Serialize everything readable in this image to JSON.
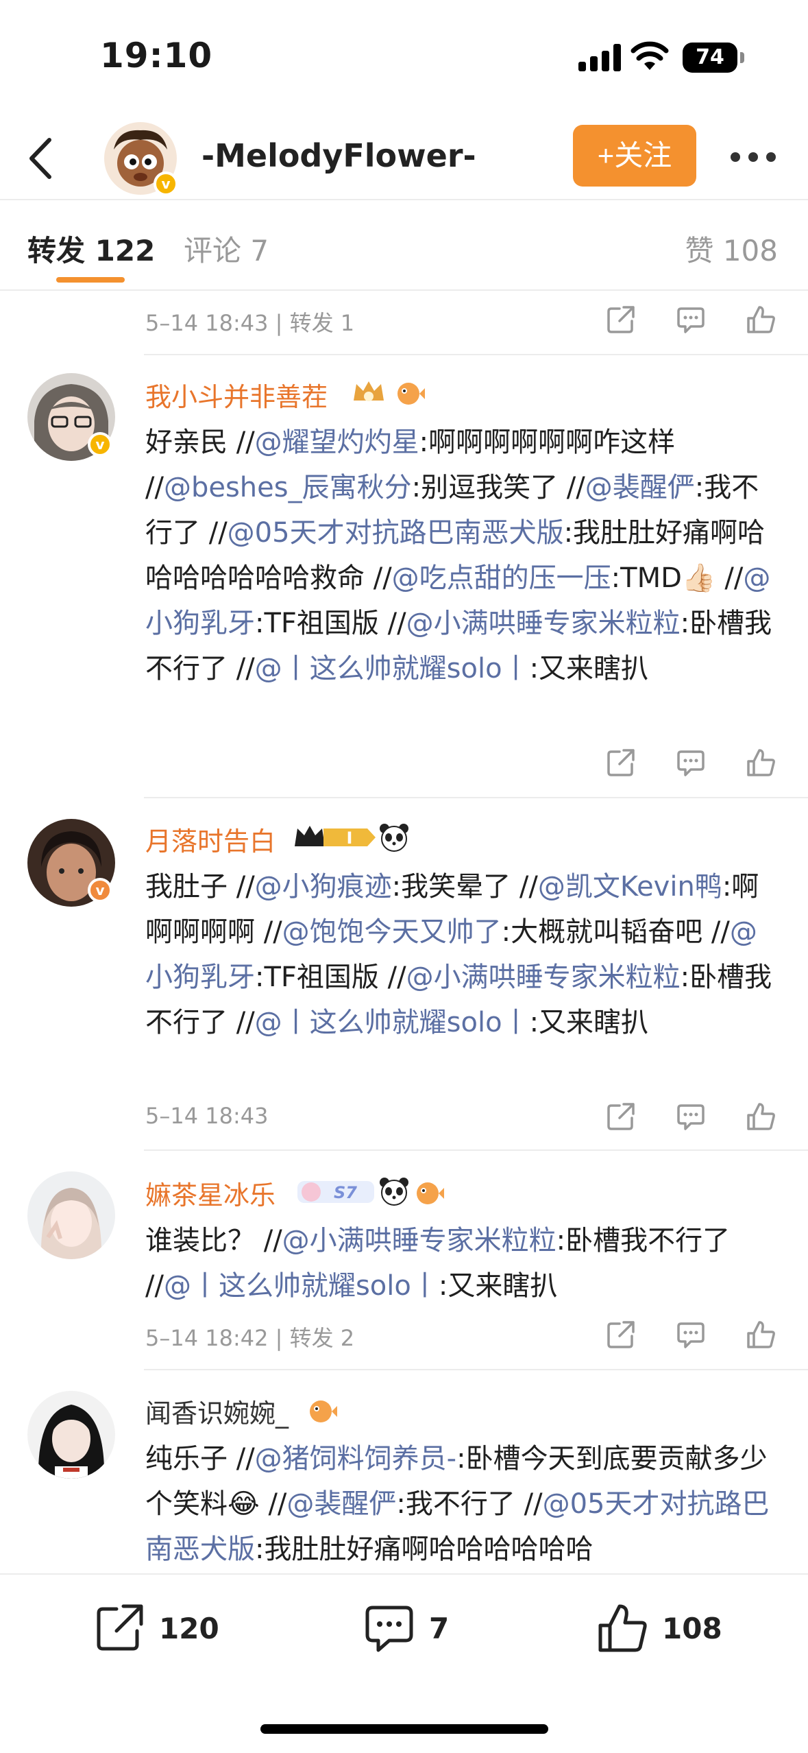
{
  "status_bar": {
    "time": "19:10",
    "battery": "74"
  },
  "header": {
    "username": "-MelodyFlower-",
    "follow_label": "+关注"
  },
  "tabs": {
    "repost": "转发 122",
    "comment": "评论 7",
    "like": "赞 108"
  },
  "top_meta": "5–14 18:43 | 转发 1",
  "posts": [
    {
      "username": "我小斗并非善茬",
      "username_color": "#e8752b",
      "segments": [
        {
          "t": "好亲民 //"
        },
        {
          "t": "@耀望灼灼星",
          "m": true
        },
        {
          "t": ":啊啊啊啊啊啊咋这样 //"
        },
        {
          "t": "@beshes_辰寓秋分",
          "m": true
        },
        {
          "t": ":别逗我笑了 //"
        },
        {
          "t": "@裴醒俨",
          "m": true
        },
        {
          "t": ":我不行了 //"
        },
        {
          "t": "@05天才对抗路巴南恶犬版",
          "m": true
        },
        {
          "t": ":我肚肚好痛啊哈哈哈哈哈哈哈救命 //"
        },
        {
          "t": "@吃点甜的压一压",
          "m": true
        },
        {
          "t": ":TMD👍🏻 //"
        },
        {
          "t": "@小狗乳牙",
          "m": true
        },
        {
          "t": ":TF祖国版 //"
        },
        {
          "t": "@小满哄睡专家米粒粒",
          "m": true
        },
        {
          "t": ":卧槽我不行了 //"
        },
        {
          "t": "@丨这么帅就耀solo丨",
          "m": true
        },
        {
          "t": ":又来瞎扒"
        }
      ],
      "meta": ""
    },
    {
      "username": "月落时告白",
      "username_color": "#e8752b",
      "segments": [
        {
          "t": "我肚子 //"
        },
        {
          "t": "@小狗痕迹",
          "m": true
        },
        {
          "t": ":我笑晕了 //"
        },
        {
          "t": "@凯文Kevin鸭",
          "m": true
        },
        {
          "t": ":啊啊啊啊啊 //"
        },
        {
          "t": "@饱饱今天又帅了",
          "m": true
        },
        {
          "t": ":大概就叫韬奋吧 //"
        },
        {
          "t": "@小狗乳牙",
          "m": true
        },
        {
          "t": ":TF祖国版 //"
        },
        {
          "t": "@小满哄睡专家米粒粒",
          "m": true
        },
        {
          "t": ":卧槽我不行了 //"
        },
        {
          "t": "@丨这么帅就耀solo丨",
          "m": true
        },
        {
          "t": ":又来瞎扒"
        }
      ],
      "meta": "5–14 18:43"
    },
    {
      "username": "嫲茶星冰乐",
      "username_color": "#e8752b",
      "badge_text": "S7",
      "segments": [
        {
          "t": "谁装比？ //"
        },
        {
          "t": "@小满哄睡专家米粒粒",
          "m": true
        },
        {
          "t": ":卧槽我不行了 //"
        },
        {
          "t": "@丨这么帅就耀solo丨",
          "m": true
        },
        {
          "t": ":又来瞎扒"
        }
      ],
      "meta": "5–14 18:42 | 转发 2"
    },
    {
      "username": "闻香识婉婉_",
      "username_color": "#333333",
      "segments": [
        {
          "t": "纯乐子 //"
        },
        {
          "t": "@猪饲料饲养员-",
          "m": true
        },
        {
          "t": ":卧槽今天到底要贡献多少个笑料😂 //"
        },
        {
          "t": "@裴醒俨",
          "m": true
        },
        {
          "t": ":我不行了 //"
        },
        {
          "t": "@05天才对抗路巴南恶犬版",
          "m": true
        },
        {
          "t": ":我肚肚好痛啊哈哈哈哈哈哈"
        }
      ],
      "meta": ""
    }
  ],
  "bottom_bar": {
    "repost_count": "120",
    "comment_count": "7",
    "like_count": "108"
  },
  "icons": {
    "back": "chevron-left-icon",
    "more": "more-icon",
    "share": "share-icon",
    "comment": "comment-icon",
    "like": "thumbs-up-icon",
    "verified": "verified-badge-icon"
  },
  "colors": {
    "accent": "#f4912f",
    "mention": "#5b6fa3",
    "vip_name": "#e8752b",
    "meta": "#999999"
  }
}
